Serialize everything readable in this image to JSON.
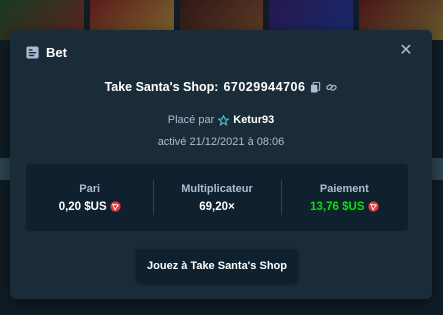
{
  "modal": {
    "title": "Bet",
    "close_icon": "close-icon",
    "game_name": "Take Santa's Shop: ",
    "bet_id": "67029944706",
    "placed_by_label": "Placé par",
    "username": "Ketur93",
    "activated": "activé 21/12/2021 à 08:06",
    "stats": {
      "bet_label": "Pari",
      "bet_value": "0,20 $US",
      "multiplier_label": "Multiplicateur",
      "multiplier_value": "69,20×",
      "payout_label": "Paiement",
      "payout_value": "13,76 $US"
    },
    "play_button": "Jouez à Take Santa's Shop"
  },
  "colors": {
    "background": "#1a2c38",
    "panel": "#0f212e",
    "muted_text": "#b1bad3",
    "payout_green": "#00e701",
    "coin_red": "#e53935"
  }
}
